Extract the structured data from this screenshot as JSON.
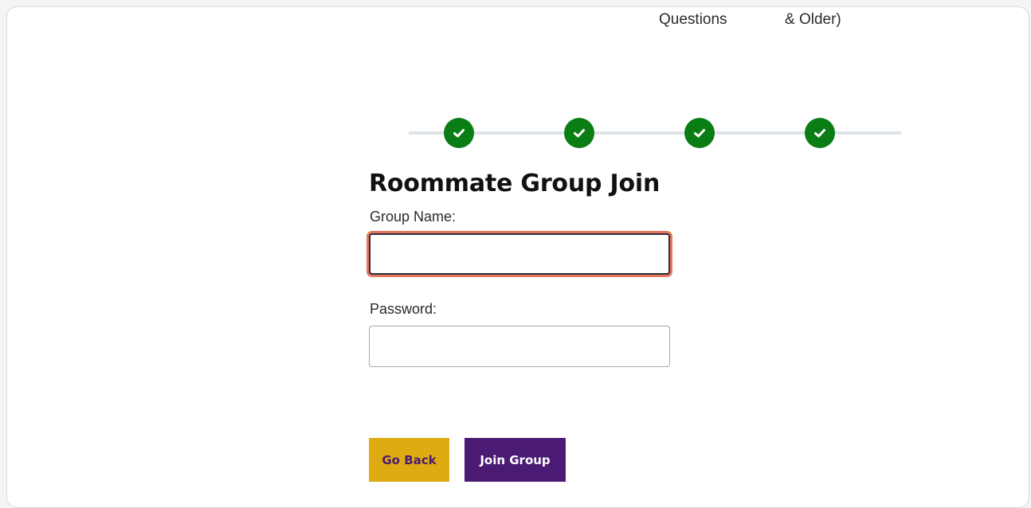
{
  "steps": {
    "partial_labels": [
      "Questions",
      "& Older)"
    ],
    "completed": [
      true,
      true,
      true,
      true
    ],
    "check_color": "#0a7d14",
    "icon": "check-circle-icon"
  },
  "form": {
    "title": "Roommate Group Join",
    "group_name": {
      "label": "Group Name:",
      "value": "",
      "placeholder": ""
    },
    "password": {
      "label": "Password:",
      "value": "",
      "placeholder": ""
    }
  },
  "buttons": {
    "back_label": "Go Back",
    "join_label": "Join Group"
  },
  "colors": {
    "back_button_bg": "#deac12",
    "join_button_bg": "#4a1a74",
    "focus_ring": "#e9765e"
  }
}
